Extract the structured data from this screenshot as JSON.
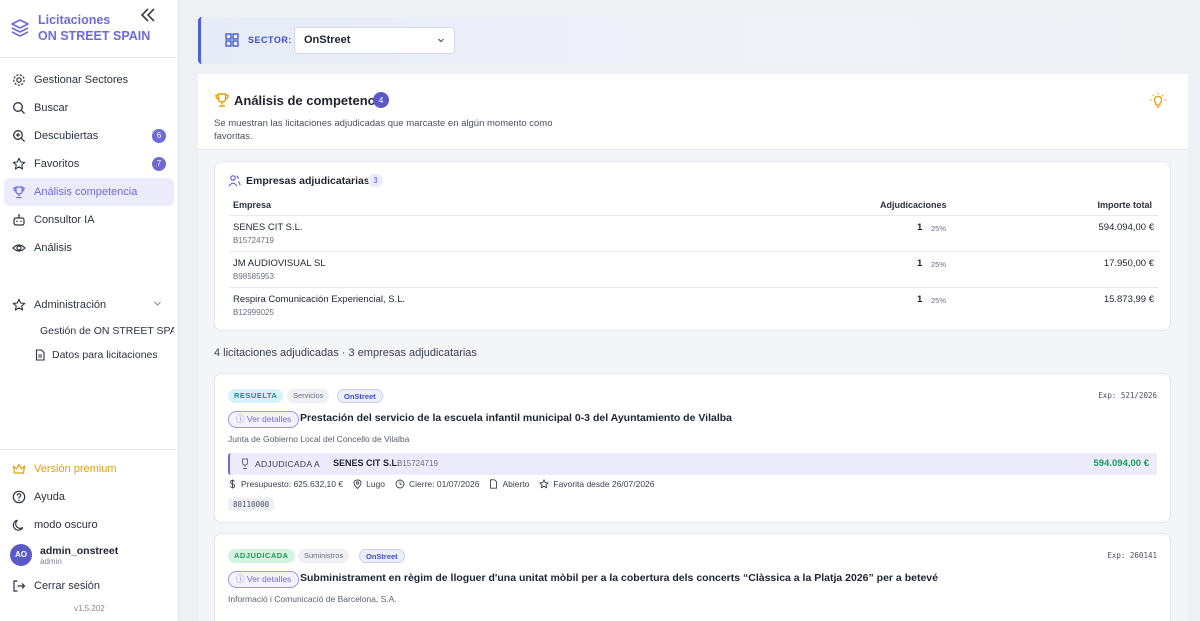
{
  "app": {
    "title_line1": "Licitaciones",
    "title_line2": "ON STREET SPAIN",
    "version": "v1.5.202"
  },
  "sidebar": {
    "items": [
      {
        "label": "Gestionar Sectores",
        "icon": "gear-icon"
      },
      {
        "label": "Buscar",
        "icon": "search-icon"
      },
      {
        "label": "Descubiertas",
        "icon": "search-plus-icon",
        "badge": "6"
      },
      {
        "label": "Favoritos",
        "icon": "star-icon",
        "badge": "7"
      },
      {
        "label": "Análisis competencia",
        "icon": "trophy-icon",
        "active": true
      },
      {
        "label": "Consultor IA",
        "icon": "robot-icon"
      },
      {
        "label": "Análisis",
        "icon": "eye-icon"
      }
    ],
    "admin": {
      "label": "Administración",
      "subitems": [
        "Gestión de ON STREET SPAIN",
        "Datos para licitaciones"
      ]
    },
    "bottom": {
      "premium": "Versión premium",
      "help": "Ayuda",
      "dark_mode": "modo oscuro",
      "logout": "Cerrar sesión"
    },
    "user": {
      "initials": "AO",
      "name": "admin_onstreet",
      "role": "admin"
    }
  },
  "sector": {
    "label": "SECTOR:",
    "selected": "OnStreet"
  },
  "header": {
    "title": "Análisis de competencia",
    "count": "4",
    "description": "Se muestran las licitaciones adjudicadas que marcaste en algún momento como favoritas."
  },
  "companies": {
    "title": "Empresas adjudicatarias",
    "count": "3",
    "columns": [
      "Empresa",
      "Adjudicaciones",
      "Importe total"
    ],
    "rows": [
      {
        "name": "SENES CIT S.L.",
        "cif": "B15724719",
        "awards": "1",
        "pct": "25%",
        "amount": "594.094,00 €"
      },
      {
        "name": "JM AUDIOVISUAL SL",
        "cif": "B98585953",
        "awards": "1",
        "pct": "25%",
        "amount": "17.950,00 €"
      },
      {
        "name": "Respira Comunicación Experiencial, S.L.",
        "cif": "B12999025",
        "awards": "1",
        "pct": "25%",
        "amount": "15.873,99 €"
      }
    ]
  },
  "summary": "4 licitaciones adjudicadas · 3 empresas adjudicatarias",
  "licitaciones": [
    {
      "status": "RESUELTA",
      "category": "Servicios",
      "sector": "OnStreet",
      "exp": "Exp: 521/2026",
      "details_label": "Ver detalles",
      "title": "Prestación del servicio de la escuela infantil municipal 0-3 del Ayuntamiento de Vilalba",
      "org": "Junta de Gobierno Local del Concello de Vilalba",
      "awarded_label": "ADJUDICADA A",
      "awarded_name": "SENES CIT S.L.",
      "awarded_cif": "B15724719",
      "awarded_amount": "594.094,00 €",
      "budget": "Presupuesto: 625.632,10 €",
      "location": "Lugo",
      "close": "Cierre: 01/07/2026",
      "procedure": "Abierto",
      "favorite": "Favorita desde 26/07/2026",
      "cpv": "80110000"
    },
    {
      "status": "ADJUDICADA",
      "category": "Suministros",
      "sector": "OnStreet",
      "exp": "Exp: 260141",
      "details_label": "Ver detalles",
      "title": "Subministrament en règim de lloguer d'una unitat mòbil per a la cobertura dels concerts “Clàssica a la Platja 2026” per a betevé",
      "org": "Informació i Comunicació de Barcelona, S.A."
    }
  ],
  "colors": {
    "accent": "#6f6ad8",
    "sector_accent": "#3b4fc9",
    "success": "#1e9a57",
    "premium": "#e59e0b"
  }
}
